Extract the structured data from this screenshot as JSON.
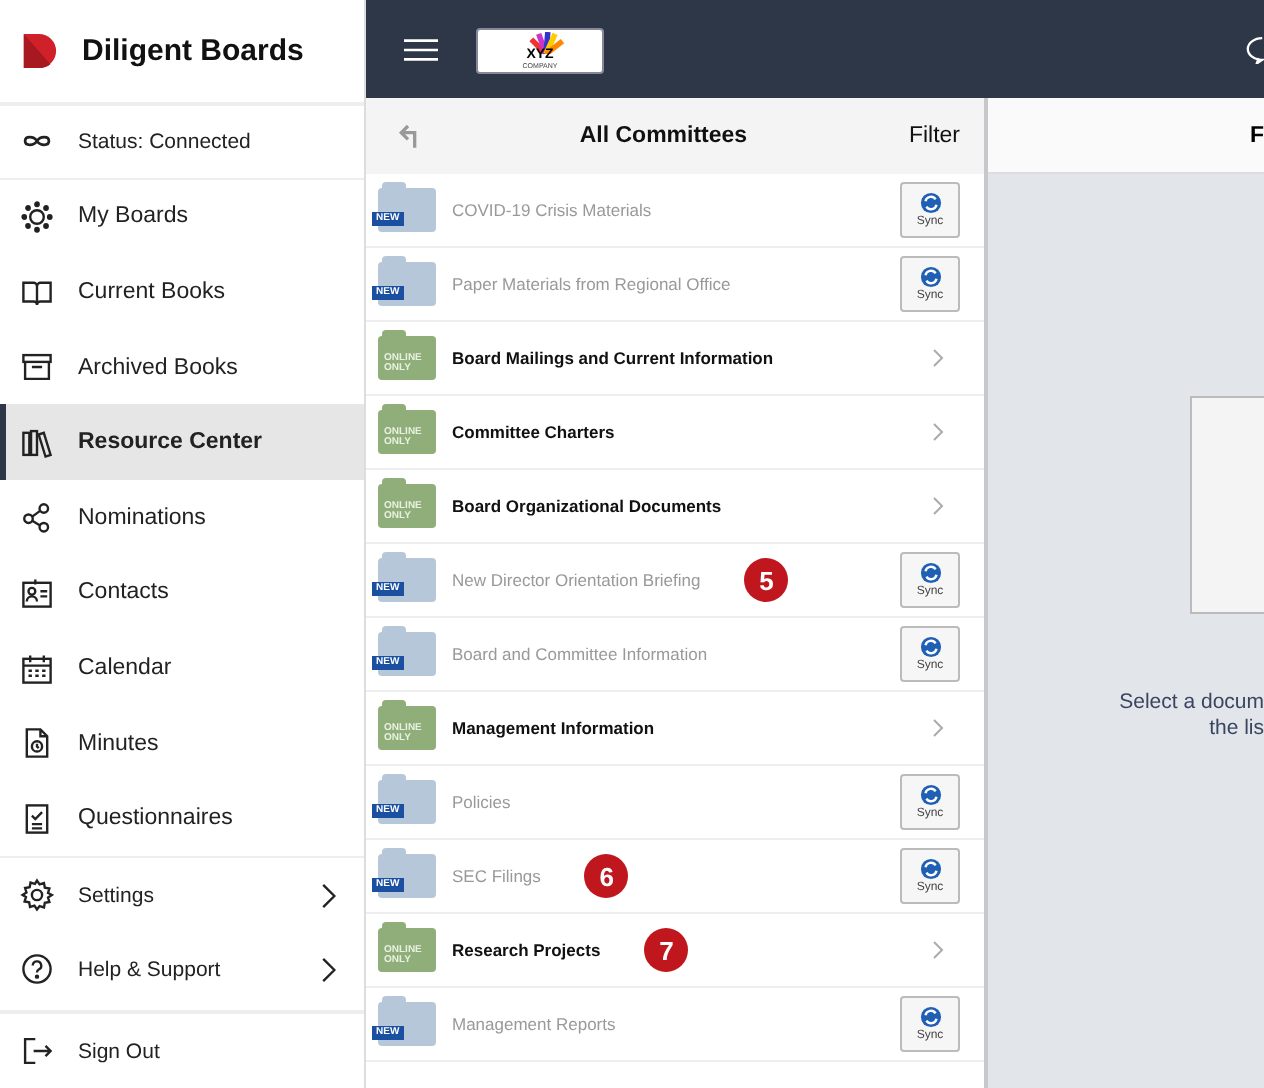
{
  "brand": {
    "name": "Diligent Boards"
  },
  "status": {
    "label": "Status: Connected"
  },
  "nav": [
    {
      "label": "My Boards",
      "selected": false
    },
    {
      "label": "Current Books",
      "selected": false
    },
    {
      "label": "Archived Books",
      "selected": false
    },
    {
      "label": "Resource Center",
      "selected": true
    },
    {
      "label": "Nominations",
      "selected": false
    },
    {
      "label": "Contacts",
      "selected": false
    },
    {
      "label": "Calendar",
      "selected": false
    },
    {
      "label": "Minutes",
      "selected": false
    },
    {
      "label": "Questionnaires",
      "selected": false
    }
  ],
  "footer_nav": [
    {
      "label": "Settings",
      "expandable": true
    },
    {
      "label": "Help & Support",
      "expandable": true
    },
    {
      "label": "Sign Out",
      "expandable": false
    }
  ],
  "header": {
    "logo_title": "XYZ",
    "logo_subtitle": "COMPANY"
  },
  "list": {
    "title": "All Committees",
    "filter": "Filter",
    "rows": [
      {
        "label": "COVID-19 Crisis Materials",
        "kind": "new",
        "badge": "NEW",
        "action": "Sync"
      },
      {
        "label": "Paper Materials from Regional Office",
        "kind": "new",
        "badge": "NEW",
        "action": "Sync"
      },
      {
        "label": "Board Mailings and Current Information",
        "kind": "online",
        "badge": "ONLINE ONLY"
      },
      {
        "label": "Committee Charters",
        "kind": "online",
        "badge": "ONLINE ONLY"
      },
      {
        "label": "Board Organizational Documents",
        "kind": "online",
        "badge": "ONLINE ONLY"
      },
      {
        "label": "New Director Orientation Briefing",
        "kind": "new",
        "badge": "NEW",
        "action": "Sync",
        "marker": "5"
      },
      {
        "label": "Board and Committee Information",
        "kind": "new",
        "badge": "NEW",
        "action": "Sync"
      },
      {
        "label": "Management Information",
        "kind": "online",
        "badge": "ONLINE ONLY"
      },
      {
        "label": "Policies",
        "kind": "new",
        "badge": "NEW",
        "action": "Sync"
      },
      {
        "label": "SEC Filings",
        "kind": "new",
        "badge": "NEW",
        "action": "Sync",
        "marker": "6"
      },
      {
        "label": "Research Projects",
        "kind": "online",
        "badge": "ONLINE ONLY",
        "marker": "7"
      },
      {
        "label": "Management Reports",
        "kind": "new",
        "badge": "NEW",
        "action": "Sync"
      }
    ]
  },
  "viewer": {
    "title": "F",
    "message_line_1": "Select a docum",
    "message_line_2": "the lis"
  }
}
